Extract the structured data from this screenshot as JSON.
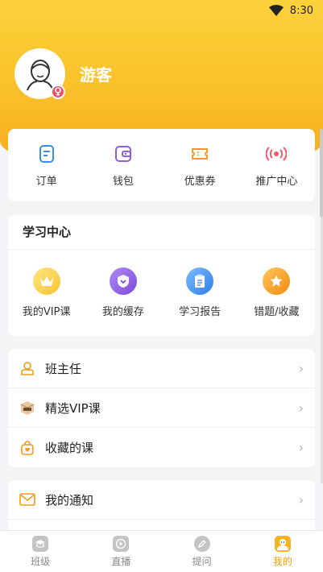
{
  "status": {
    "time": "8:30"
  },
  "profile": {
    "name": "游客"
  },
  "quick": [
    {
      "label": "订单",
      "icon": "order-icon",
      "color": "#3d8ae8"
    },
    {
      "label": "钱包",
      "icon": "wallet-icon",
      "color": "#8b5fe6"
    },
    {
      "label": "优惠券",
      "icon": "coupon-icon",
      "color": "#f39a2a"
    },
    {
      "label": "推广中心",
      "icon": "broadcast-icon",
      "color": "#ee5b6e"
    }
  ],
  "learning": {
    "title": "学习中心",
    "items": [
      {
        "label": "我的VIP课",
        "icon": "crown-icon",
        "color": "#f6c42e"
      },
      {
        "label": "我的缓存",
        "icon": "cache-shield-icon",
        "color": "#8a5ae0"
      },
      {
        "label": "学习报告",
        "icon": "report-icon",
        "color": "#3f8ff0"
      },
      {
        "label": "错题/收藏",
        "icon": "star-icon",
        "color": "#f69a1e"
      }
    ]
  },
  "list": [
    {
      "label": "班主任",
      "icon": "teacher-icon"
    },
    {
      "label": "精选VIP课",
      "icon": "vip-box-icon"
    },
    {
      "label": "收藏的课",
      "icon": "favorite-bag-icon"
    }
  ],
  "notify": {
    "label": "我的通知",
    "icon": "mail-icon"
  },
  "tabs": [
    {
      "label": "班级",
      "icon": "class-icon"
    },
    {
      "label": "直播",
      "icon": "live-icon"
    },
    {
      "label": "提问",
      "icon": "question-icon"
    },
    {
      "label": "我的",
      "icon": "profile-icon"
    }
  ],
  "colors": {
    "accent": "#f6a91d",
    "active_tab": "#f0a300"
  }
}
